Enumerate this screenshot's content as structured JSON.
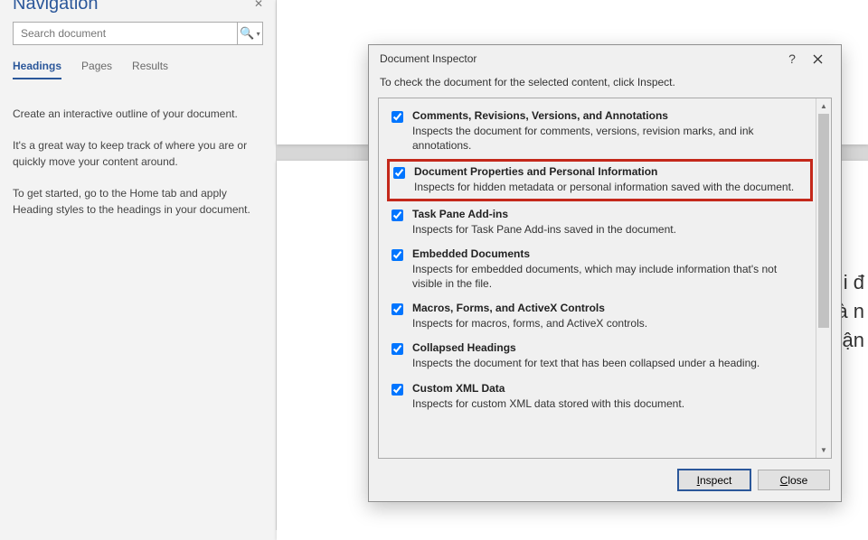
{
  "nav": {
    "title": "Navigation",
    "close_glyph": "✕",
    "search_placeholder": "Search document",
    "tabs": [
      "Headings",
      "Pages",
      "Results"
    ],
    "body": [
      "Create an interactive outline of your document.",
      "It's a great way to keep track of where you are or quickly move your content around.",
      "To get started, go to the Home tab and apply Heading styles to the headings in your document."
    ]
  },
  "page_snippet": [
    "i đ",
    "à n",
    "ận"
  ],
  "dialog": {
    "title": "Document Inspector",
    "help_glyph": "?",
    "instruction": "To check the document for the selected content, click Inspect.",
    "items": [
      {
        "title": "Comments, Revisions, Versions, and Annotations",
        "desc": "Inspects the document for comments, versions, revision marks, and ink annotations.",
        "checked": true,
        "highlight": false
      },
      {
        "title": "Document Properties and Personal Information",
        "desc": "Inspects for hidden metadata or personal information saved with the document.",
        "checked": true,
        "highlight": true
      },
      {
        "title": "Task Pane Add-ins",
        "desc": "Inspects for Task Pane Add-ins saved in the document.",
        "checked": true,
        "highlight": false
      },
      {
        "title": "Embedded Documents",
        "desc": "Inspects for embedded documents, which may include information that's not visible in the file.",
        "checked": true,
        "highlight": false
      },
      {
        "title": "Macros, Forms, and ActiveX Controls",
        "desc": "Inspects for macros, forms, and ActiveX controls.",
        "checked": true,
        "highlight": false
      },
      {
        "title": "Collapsed Headings",
        "desc": "Inspects the document for text that has been collapsed under a heading.",
        "checked": true,
        "highlight": false
      },
      {
        "title": "Custom XML Data",
        "desc": "Inspects for custom XML data stored with this document.",
        "checked": true,
        "highlight": false
      }
    ],
    "buttons": {
      "inspect": "Inspect",
      "close": "Close"
    }
  }
}
